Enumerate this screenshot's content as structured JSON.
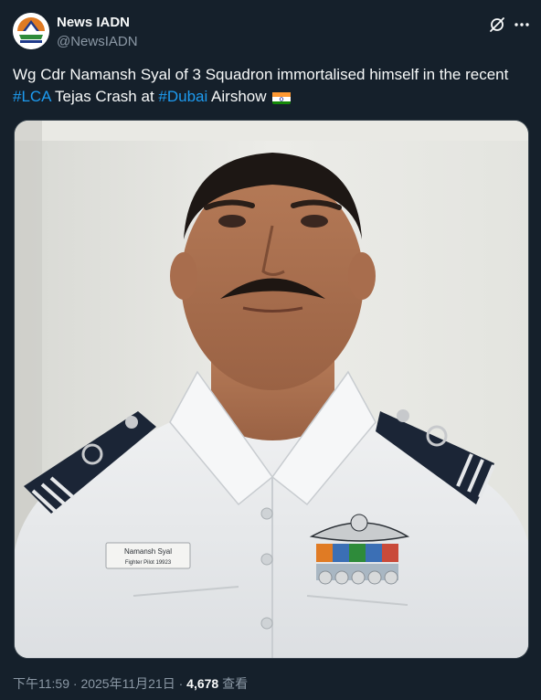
{
  "author": {
    "name": "News IADN",
    "handle": "@NewsIADN"
  },
  "tweet": {
    "text_start": "Wg Cdr Namansh Syal of 3 Squadron immortalised himself in the recent",
    "hashtag1": "#LCA",
    "text_mid": " Tejas Crash at ",
    "hashtag2": "#Dubai",
    "text_end": " Airshow",
    "emoji": "india-flag-icon"
  },
  "media": {
    "name_plate": "Namansh Syal",
    "name_plate_sub": "Fighter Pilot 19923"
  },
  "meta": {
    "time": "下午11:59",
    "separator": " · ",
    "date": "2025年11月21日",
    "views_count": "4,678",
    "views_label": " 查看"
  },
  "colors": {
    "background": "#15202b",
    "accent": "#1d9bf0",
    "muted": "#8b98a5"
  }
}
